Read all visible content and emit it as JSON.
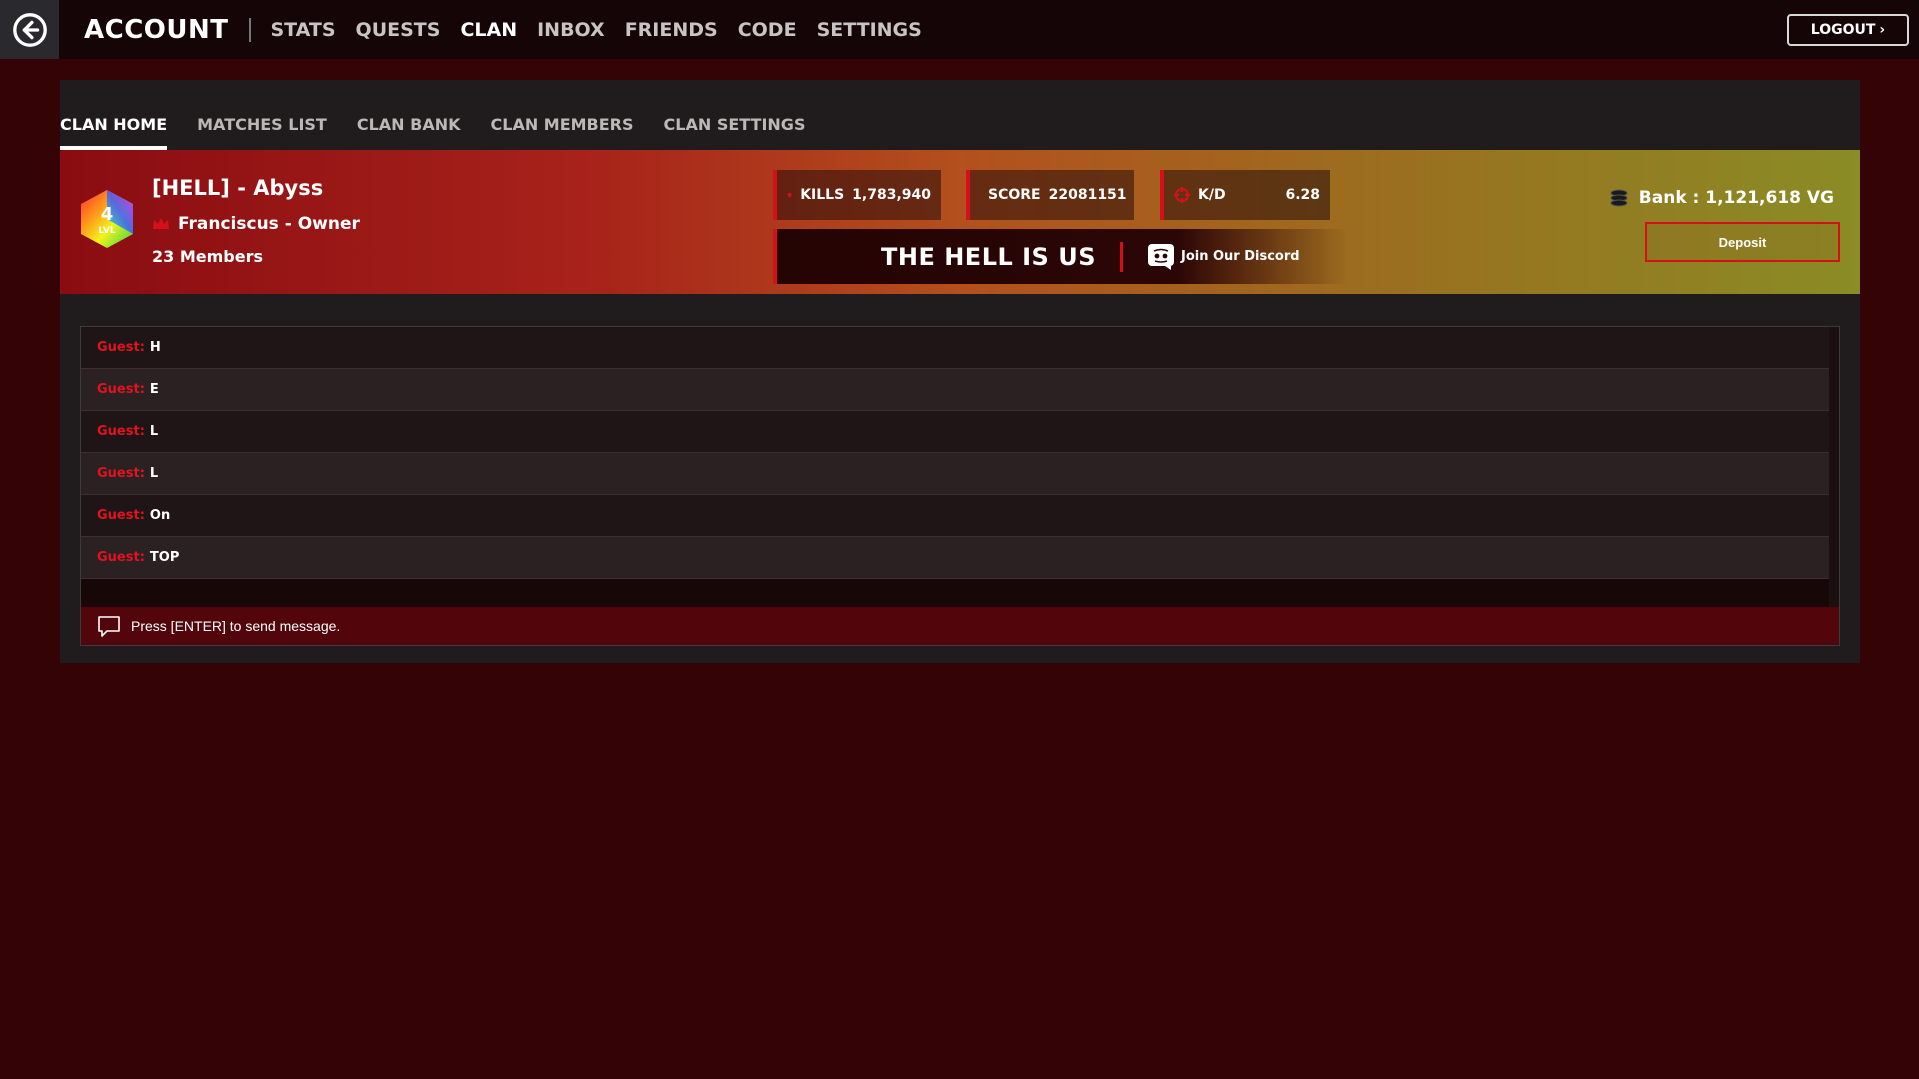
{
  "topbar": {
    "brand": "ACCOUNT",
    "nav": [
      "STATS",
      "QUESTS",
      "CLAN",
      "INBOX",
      "FRIENDS",
      "CODE",
      "SETTINGS"
    ],
    "active_nav": "CLAN",
    "logout_label": "LOGOUT",
    "logout_icon": "chevron-right-icon",
    "back_icon": "arrow-left-circle-icon"
  },
  "subtabs": [
    "CLAN HOME",
    "MATCHES LIST",
    "CLAN BANK",
    "CLAN MEMBERS",
    "CLAN SETTINGS"
  ],
  "active_subtab": "CLAN HOME",
  "clan": {
    "name": "[HELL] - Abyss",
    "level": "4",
    "level_label": "LVL",
    "owner": "Franciscus - Owner",
    "members": "23 Members",
    "kills_label": "KILLS",
    "kills": "1,783,940",
    "score_label": "SCORE",
    "score": "22081151",
    "kd_label": "K/D",
    "kd": "6.28",
    "motto": "THE HELL IS US",
    "discord_label": "Join Our Discord",
    "bank_label": "Bank : 1,121,618 VG",
    "deposit_label": "Deposit"
  },
  "chat": {
    "messages": [
      {
        "user": "Guest:",
        "text": "H"
      },
      {
        "user": "Guest:",
        "text": "E"
      },
      {
        "user": "Guest:",
        "text": "L"
      },
      {
        "user": "Guest:",
        "text": "L"
      },
      {
        "user": "Guest:",
        "text": "On"
      },
      {
        "user": "Guest:",
        "text": "TOP"
      }
    ],
    "placeholder": "Press [ENTER] to send message."
  },
  "colors": {
    "background": "#340306",
    "accent_red": "#d6101a",
    "chat_user": "#e0141f"
  }
}
